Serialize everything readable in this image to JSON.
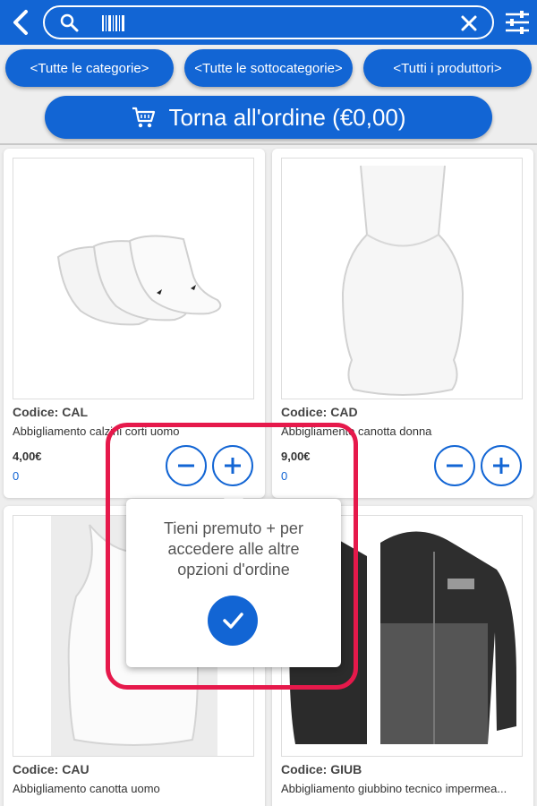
{
  "search": {
    "value": "",
    "placeholder": ""
  },
  "filters": {
    "categories": "<Tutte le categorie>",
    "subcategories": "<Tutte le sottocategorie>",
    "producers": "<Tutti i produttori>"
  },
  "order_button": {
    "label": "Torna all'ordine (€0,00)"
  },
  "products": [
    {
      "code": "Codice: CAL",
      "description": "Abbigliamento calzini corti uomo",
      "price": "4,00€",
      "quantity": "0",
      "image": "socks-image"
    },
    {
      "code": "Codice: CAD",
      "description": "Abbigliamento canotta donna",
      "price": "9,00€",
      "quantity": "0",
      "image": "tank-top-women-image"
    },
    {
      "code": "Codice: CAU",
      "description": "Abbigliamento canotta uomo",
      "image": "tank-top-men-image"
    },
    {
      "code": "Codice: GIUB",
      "description": "Abbigliamento giubbino tecnico impermea...",
      "image": "jacket-image"
    }
  ],
  "tooltip": {
    "text": "Tieni premuto + per\naccedere alle altre\nopzioni d'ordine"
  },
  "icons": {
    "back": "chevron-left-icon",
    "search": "search-icon",
    "barcode": "barcode-icon",
    "clear": "close-icon",
    "filter": "sliders-icon",
    "cart": "cart-icon",
    "minus": "minus-icon",
    "plus": "plus-icon",
    "check": "check-icon"
  },
  "colors": {
    "primary": "#1265d4",
    "highlight": "#e6194b",
    "background": "#eeeeee"
  }
}
